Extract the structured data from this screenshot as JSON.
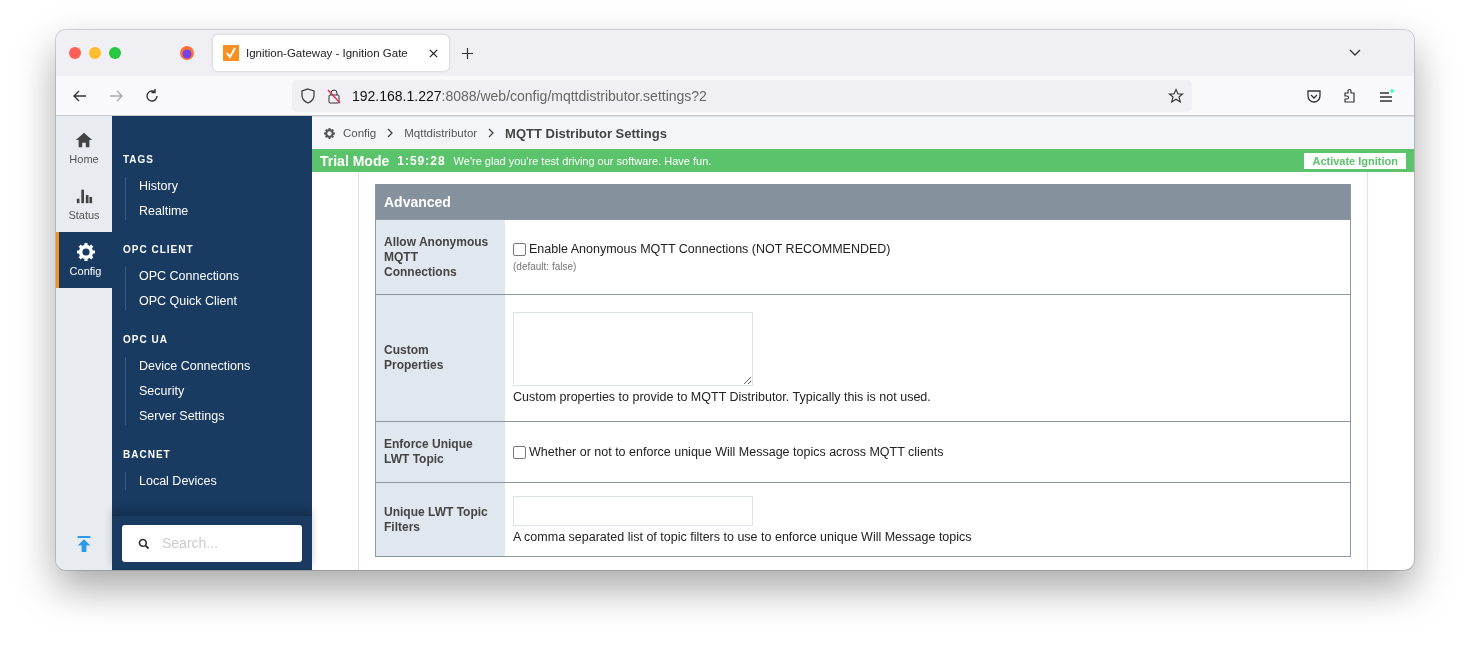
{
  "browser": {
    "tab_title": "Ignition-Gateway - Ignition Gate",
    "url_host": "192.168.1.227",
    "url_path": ":8088/web/config/mqttdistributor.settings?2"
  },
  "rail": {
    "items": [
      {
        "label": "Home",
        "selected": false
      },
      {
        "label": "Status",
        "selected": false
      },
      {
        "label": "Config",
        "selected": true
      }
    ]
  },
  "nav": {
    "sections": [
      {
        "heading": "TAGS",
        "items": [
          "History",
          "Realtime"
        ]
      },
      {
        "heading": "OPC CLIENT",
        "items": [
          "OPC Connections",
          "OPC Quick Client"
        ]
      },
      {
        "heading": "OPC UA",
        "items": [
          "Device Connections",
          "Security",
          "Server Settings"
        ]
      },
      {
        "heading": "BACNET",
        "items": [
          "Local Devices"
        ]
      }
    ],
    "search": {
      "placeholder": "Search..."
    }
  },
  "breadcrumb": [
    "Config",
    "Mqttdistributor",
    "MQTT Distributor Settings"
  ],
  "trial": {
    "title": "Trial Mode",
    "time": "1:59:28",
    "message": "We're glad you're test driving our software. Have fun.",
    "button": "Activate Ignition"
  },
  "panel": {
    "title": "Advanced",
    "rows": [
      {
        "label": "Allow Anonymous MQTT Connections",
        "kind": "checkbox",
        "checked": false,
        "text": "Enable Anonymous MQTT Connections (NOT RECOMMENDED)",
        "note": "(default: false)"
      },
      {
        "label": "Custom Properties",
        "kind": "textarea",
        "text": "Custom properties to provide to MQTT Distributor. Typically this is not used."
      },
      {
        "label": "Enforce Unique LWT Topic",
        "kind": "checkbox",
        "checked": false,
        "text": "Whether or not to enforce unique Will Message topics across MQTT clients"
      },
      {
        "label": "Unique LWT Topic Filters",
        "kind": "input",
        "text": "A comma separated list of topic filters to use to enforce unique Will Message topics"
      }
    ]
  }
}
